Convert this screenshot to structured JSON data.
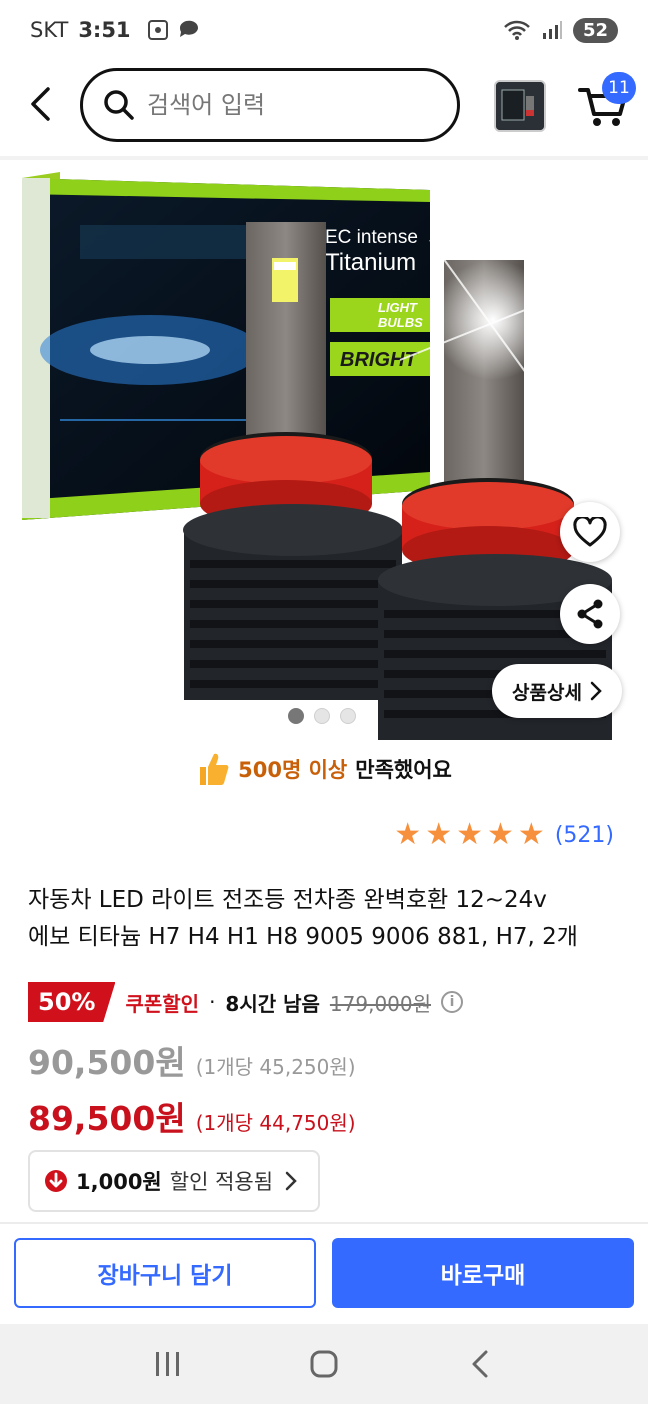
{
  "status_bar": {
    "carrier": "SKT",
    "time": "3:51",
    "battery": "52"
  },
  "header": {
    "search_placeholder": "검색어 입력",
    "cart_count": "11",
    "icons": [
      "back-arrow-icon",
      "search-icon",
      "product-thumbnail",
      "cart-icon"
    ]
  },
  "product_image": {
    "box_text_line1": "EC intense",
    "box_text_line2": "Titanium",
    "box_text_line3": "LIGHT",
    "box_text_line4": "BULBS",
    "box_text_line5": "BRIGHT",
    "carousel_total": 3,
    "carousel_active": 1,
    "detail_button": "상품상세",
    "icons": [
      "heart-icon",
      "share-icon",
      "chevron-right-icon"
    ]
  },
  "satisfaction": {
    "highlight": "500명 이상",
    "text": "만족했어요",
    "icon": "thumbs-up-icon"
  },
  "rating": {
    "stars": 5,
    "review_count": "(521)"
  },
  "product": {
    "title_line1": "자동차 LED 라이트 전조등 전차종 완벽호환 12~24v",
    "title_line2": "에보 티타늄 H7 H4 H1 H8 9005 9006 881, H7, 2개"
  },
  "price": {
    "discount_rate": "50%",
    "coupon_label": "쿠폰할인",
    "separator": "·",
    "time_left": "8시간 남음",
    "original_price": "179,000원",
    "sale_price": "90,500원",
    "sale_unit_price": "(1개당 45,250원)",
    "final_price": "89,500원",
    "final_unit_price": "(1개당 44,750원)",
    "coupon_amount": "1,000원",
    "coupon_text": "할인 적용됨"
  },
  "actions": {
    "add_to_cart": "장바구니 담기",
    "buy_now": "바로구매"
  },
  "colors": {
    "accent_blue": "#346aff",
    "discount_red": "#d0111c",
    "star_orange": "#f6903c",
    "highlight_orange": "#c8600a"
  }
}
